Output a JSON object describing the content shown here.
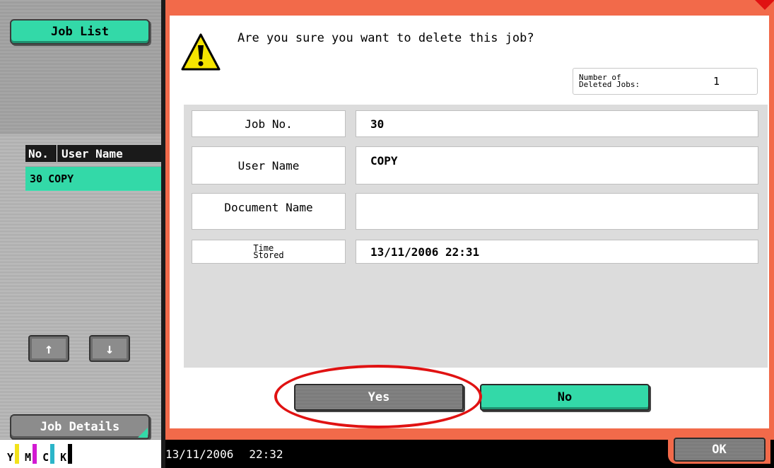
{
  "sidebar": {
    "job_list_label": "Job List",
    "list_header": {
      "no": "No.",
      "user_name": "User Name"
    },
    "rows": [
      {
        "no": "30",
        "user_name": "COPY"
      }
    ],
    "job_details_label": "Job Details",
    "up_arrow": "↑",
    "down_arrow": "↓",
    "toner": [
      {
        "label": "Y",
        "color": "#f2e21a"
      },
      {
        "label": "M",
        "color": "#d21ad2"
      },
      {
        "label": "C",
        "color": "#2bb5c9"
      },
      {
        "label": "K",
        "color": "#000000"
      }
    ]
  },
  "dialog": {
    "question": "Are you sure you want to delete this job?",
    "deleted_jobs_label_line1": "Number of",
    "deleted_jobs_label_line2": "Deleted Jobs:",
    "deleted_jobs_value": "1",
    "fields": {
      "job_no_label": "Job No.",
      "job_no_value": "30",
      "user_name_label": "User Name",
      "user_name_value": "COPY",
      "document_name_label": "Document Name",
      "document_name_value": "",
      "time_label_line1": "Time",
      "time_label_line2": "Stored",
      "time_value": "13/11/2006  22:31"
    },
    "yes_label": "Yes",
    "no_label": "No"
  },
  "statusbar": {
    "date": "13/11/2006",
    "time": "22:32",
    "ok_label": "OK"
  },
  "colors": {
    "accent_green": "#33d9a8",
    "frame_orange": "#f26a4a",
    "highlight_red": "#e01212"
  }
}
